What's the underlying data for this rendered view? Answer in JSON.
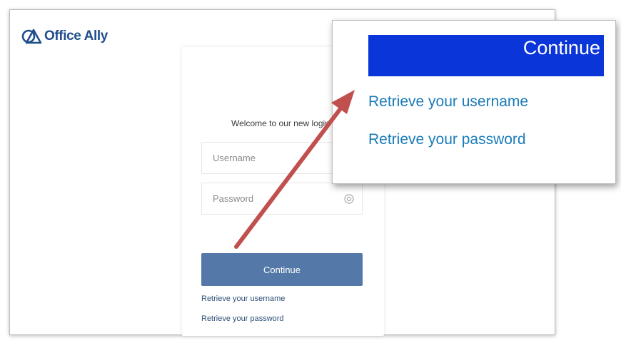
{
  "header": {
    "logo_text": "Office Ally"
  },
  "login": {
    "welcome_text": "Welcome to our new login page",
    "username_placeholder": "Username",
    "password_placeholder": "Password",
    "continue_label": "Continue",
    "retrieve_username": "Retrieve your username",
    "retrieve_password": "Retrieve your password"
  },
  "zoom_callout": {
    "continue_label": "Continue",
    "retrieve_username": "Retrieve your username",
    "retrieve_password": "Retrieve your password"
  },
  "icons": [
    "office-ally-logo-icon",
    "eye-icon",
    "annotation-arrow"
  ],
  "colors": {
    "brand": "#1f4e8c",
    "continue_button": "#5479a8",
    "zoom_continue_button": "#0a35d9",
    "link": "#1a7bb8",
    "annotation_arrow": "#c0504d"
  }
}
